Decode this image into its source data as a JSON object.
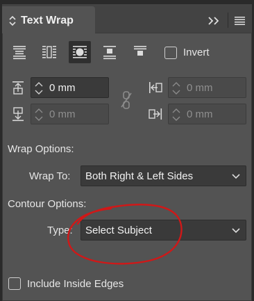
{
  "panel": {
    "title": "Text Wrap",
    "icons": {
      "collapse": "collapse-arrows-icon",
      "expand": "expand-panel-icon",
      "menu": "panel-menu-icon"
    }
  },
  "wrap_buttons": [
    {
      "name": "no-text-wrap",
      "active": false
    },
    {
      "name": "wrap-around-bounding-box",
      "active": false
    },
    {
      "name": "wrap-around-object-shape",
      "active": true
    },
    {
      "name": "jump-object",
      "active": false
    },
    {
      "name": "jump-to-next-column",
      "active": false
    }
  ],
  "invert": {
    "label": "Invert",
    "checked": false
  },
  "offsets": {
    "top": "0 mm",
    "bottom": "0 mm",
    "left": "0 mm",
    "right": "0 mm"
  },
  "wrap_options": {
    "heading": "Wrap Options:",
    "wrap_to_label": "Wrap To:",
    "wrap_to_value": "Both Right & Left Sides"
  },
  "contour_options": {
    "heading": "Contour Options:",
    "type_label": "Type:",
    "type_value": "Select Subject"
  },
  "include_inside_edges": {
    "label": "Include Inside Edges",
    "checked": false
  },
  "colors": {
    "panel_bg": "#535353",
    "annotation": "#d01818"
  }
}
